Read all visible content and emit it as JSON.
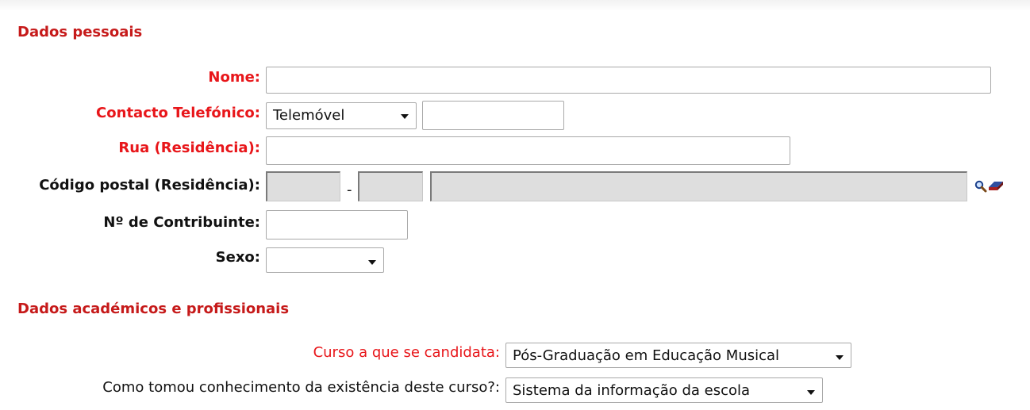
{
  "sections": {
    "personal_title": "Dados pessoais",
    "academic_title": "Dados académicos e profissionais"
  },
  "fields": {
    "name": {
      "label": "Nome:",
      "value": ""
    },
    "phone": {
      "label": "Contacto Telefónico:",
      "type_selected": "Telemóvel",
      "value": ""
    },
    "street": {
      "label": "Rua (Residência):",
      "value": ""
    },
    "postal": {
      "label": "Código postal (Residência):",
      "part1": "",
      "separator": "-",
      "part2": "",
      "locality": ""
    },
    "tax_id": {
      "label": "Nº de Contribuinte:",
      "value": ""
    },
    "sex": {
      "label": "Sexo:",
      "selected": ""
    },
    "course": {
      "label": "Curso a que se candidata:",
      "selected": "Pós-Graduação em Educação Musical"
    },
    "source": {
      "label": "Como tomou conhecimento da existência deste curso?:",
      "selected": "Sistema da informação da escola"
    }
  },
  "icons": {
    "search": "search-icon",
    "eraser": "eraser-icon"
  },
  "colors": {
    "required_label": "#e8161a",
    "section_title": "#c61a1a",
    "disabled_field": "#dedede"
  }
}
